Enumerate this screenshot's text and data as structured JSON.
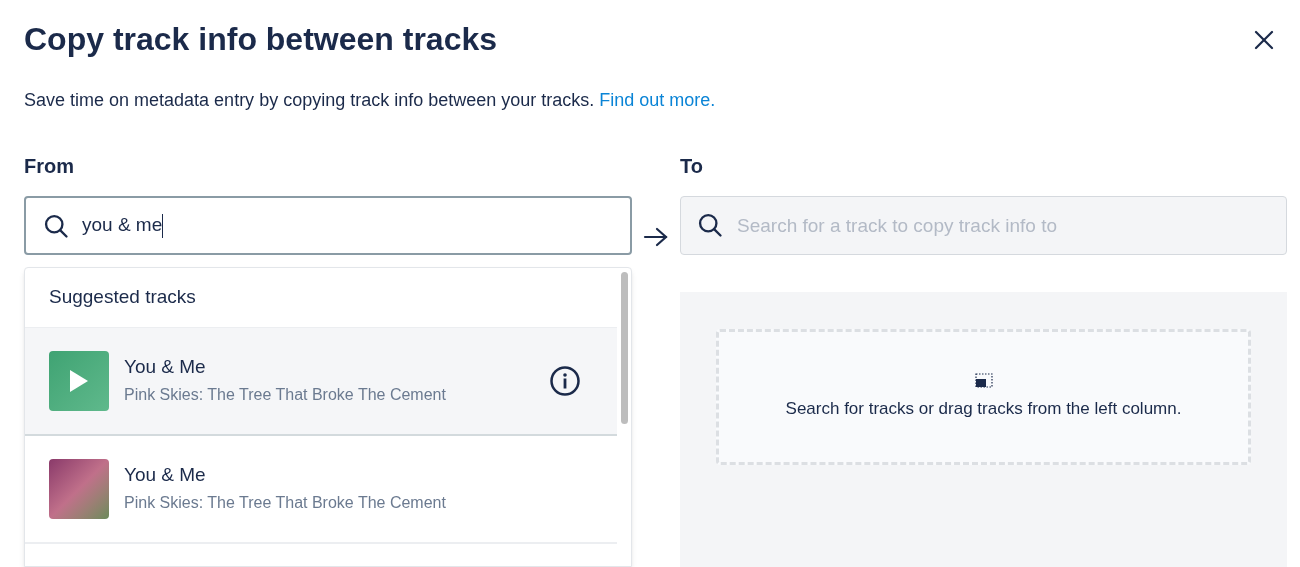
{
  "dialog": {
    "title": "Copy track info between tracks",
    "description": "Save time on metadata entry by copying track info between your tracks.",
    "link": "Find out more."
  },
  "from": {
    "label": "From",
    "value": "you & me",
    "focused": true
  },
  "to": {
    "label": "To",
    "placeholder": "Search for a track to copy track info to"
  },
  "suggestions": {
    "heading": "Suggested tracks",
    "tracks": [
      {
        "title": "You & Me",
        "subtitle": "Pink Skies: The Tree That Broke The Cement",
        "hovered": true
      },
      {
        "title": "You & Me",
        "subtitle": "Pink Skies: The Tree That Broke The Cement",
        "hovered": false
      }
    ]
  },
  "drop_zone": {
    "text": "Search for tracks or drag tracks from the left column."
  }
}
